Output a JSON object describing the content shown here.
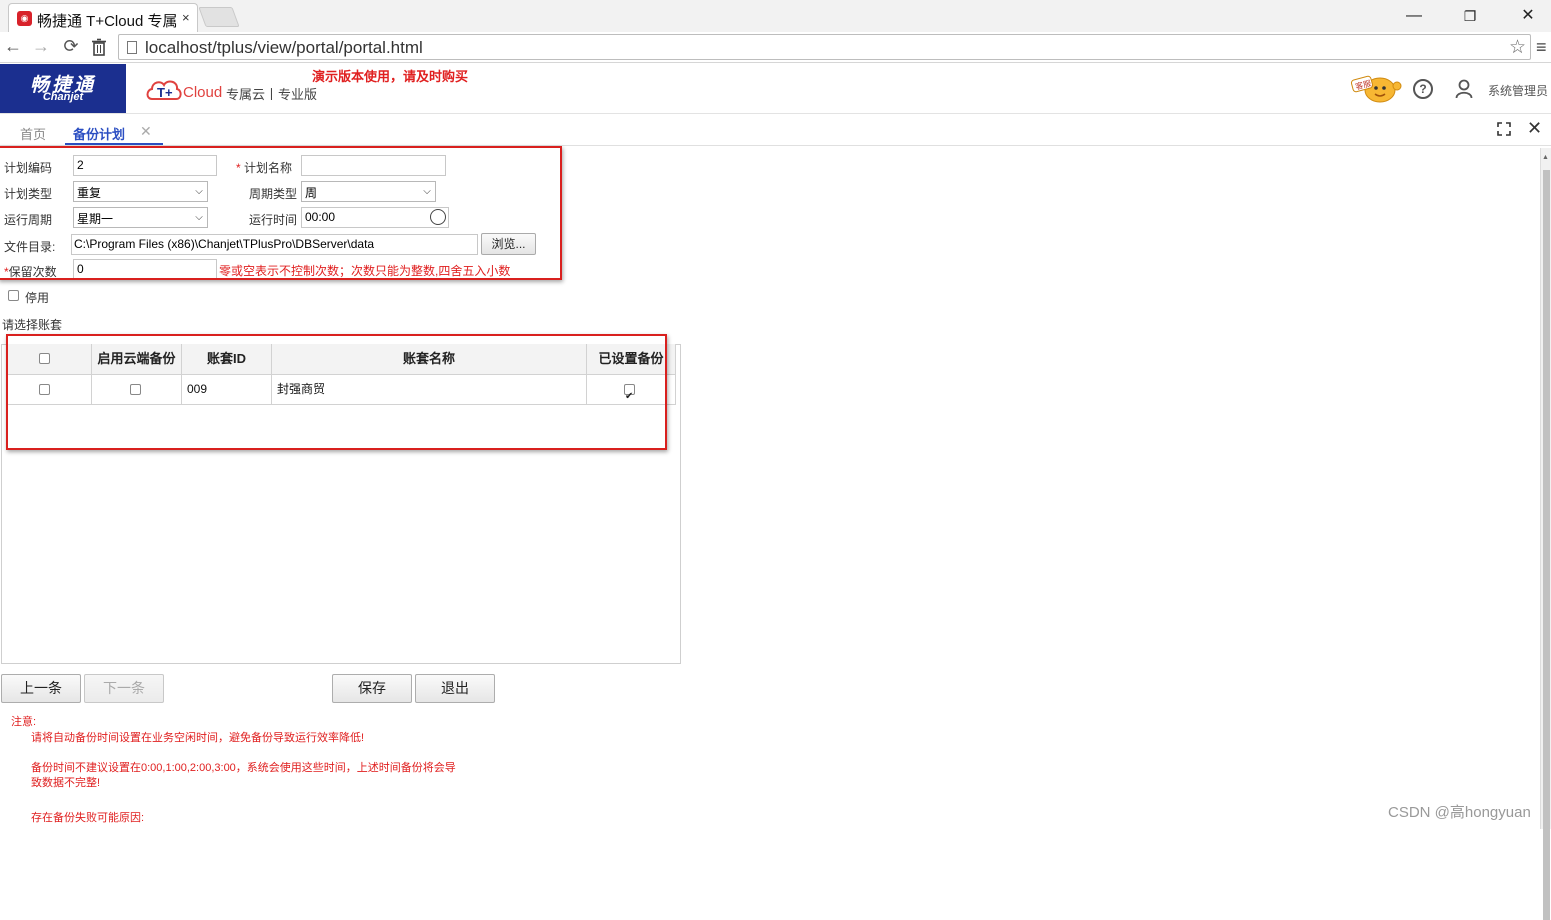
{
  "browser": {
    "tab_title": "畅捷通 T+Cloud 专属",
    "tab_close": "×",
    "url": "localhost/tplus/view/portal/portal.html",
    "minimize": "—",
    "restore": "❐",
    "close": "✕"
  },
  "header": {
    "brand_cn": "畅捷通",
    "brand_en": "Chanjet",
    "cloud_text": "Cloud",
    "cloud_sub": "专属云丨专业版",
    "demo_notice": "演示版本使用，请及时购买",
    "service_badge": "客服",
    "user_name": "系统管理员"
  },
  "tabs": {
    "home": "首页",
    "active": "备份计划",
    "active_close": "✕"
  },
  "form": {
    "plan_code_label": "计划编码",
    "plan_code_value": "2",
    "plan_name_label": "计划名称",
    "plan_name_value": "",
    "plan_type_label": "计划类型",
    "plan_type_value": "重复",
    "cycle_type_label": "周期类型",
    "cycle_type_value": "周",
    "run_cycle_label": "运行周期",
    "run_cycle_value": "星期一",
    "run_time_label": "运行时间",
    "run_time_value": "00:00",
    "dir_label": "文件目录:",
    "dir_value": "C:\\Program Files (x86)\\Chanjet\\TPlusPro\\DBServer\\data",
    "browse_label": "浏览...",
    "keep_label": "保留次数",
    "keep_value": "0",
    "keep_hint": "零或空表示不控制次数；次数只能为整数,四舍五入小数",
    "disable_label": "停用",
    "select_accounts_label": "请选择账套"
  },
  "grid": {
    "headers": [
      "启用云端备份",
      "账套ID",
      "账套名称",
      "已设置备份"
    ],
    "rows": [
      {
        "selected": false,
        "cloud_backup": false,
        "id": "009",
        "name": "封强商贸",
        "has_backup": true
      }
    ]
  },
  "buttons": {
    "prev": "上一条",
    "next": "下一条",
    "save": "保存",
    "exit": "退出"
  },
  "notes": {
    "title": "注意:",
    "line1": "请将自动备份时间设置在业务空闲时间，避免备份导致运行效率降低!",
    "line2a": "备份时间不建议设置在0:00,1:00,2:00,3:00，系统会使用这些时间，上述时间备份将会导",
    "line2b": "致数据不完整!",
    "line3": "存在备份失败可能原因:"
  },
  "watermark": "CSDN @高hongyuan",
  "colors": {
    "brand_blue": "#1b2f8f",
    "accent_blue": "#2c4fc2",
    "alert_red": "#e02020"
  }
}
